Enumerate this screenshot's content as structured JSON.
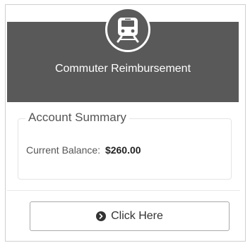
{
  "card": {
    "title": "Commuter Reimbursement",
    "icon": "train-icon"
  },
  "summary": {
    "heading": "Account Summary",
    "balance_label": "Current Balance:",
    "balance_value": "$260.00"
  },
  "action": {
    "icon": "chevron-circle-right-icon",
    "label": "Click Here"
  },
  "colors": {
    "header_bg": "#595959",
    "text": "#555555"
  }
}
